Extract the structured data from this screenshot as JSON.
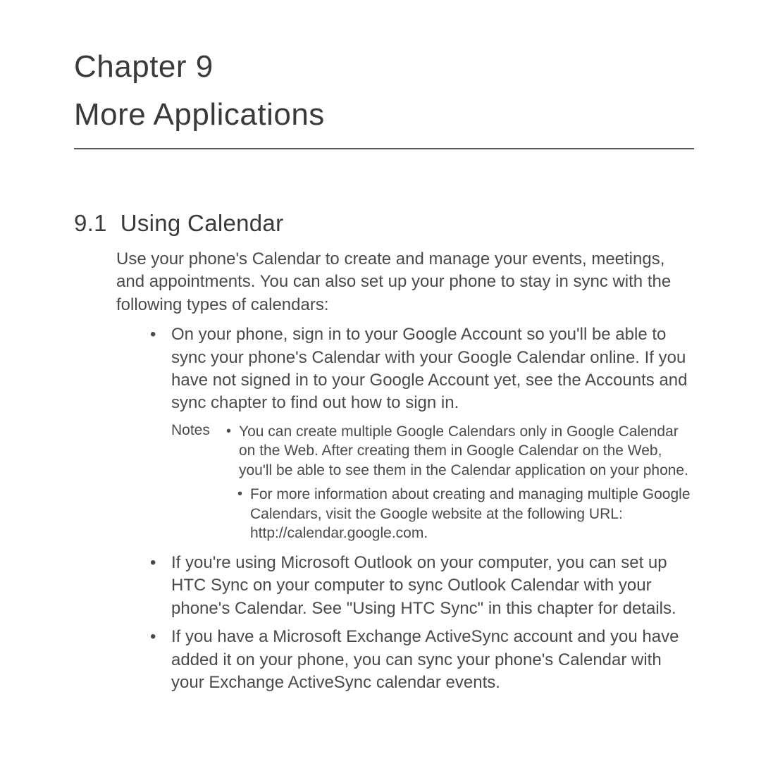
{
  "chapter": {
    "heading": "Chapter 9",
    "title": "More Applications"
  },
  "section": {
    "number": "9.1",
    "title": "Using Calendar",
    "intro": "Use your phone's Calendar to create and manage your events, meetings, and appointments. You can also set up your phone to stay in sync with the following types of calendars:",
    "bullets": [
      "On your phone, sign in to your Google Account so you'll be able to sync your phone's Calendar with your Google Calendar online. If you have not signed in to your Google Account yet, see the Accounts and sync chapter to find out how to sign in.",
      "If you're using Microsoft Outlook on your computer, you can set up HTC Sync on your computer to sync Outlook Calendar with your phone's Calendar. See \"Using HTC Sync\" in this chapter for details.",
      "If you have a Microsoft Exchange ActiveSync account and you have added it on your phone, you can sync your phone's Calendar with your Exchange ActiveSync calendar events."
    ],
    "notes": {
      "label": "Notes",
      "items": [
        "You can create multiple Google Calendars only in Google Calendar on the Web. After creating them in Google Calendar on the Web, you'll be able to see them in the Calendar application on your phone.",
        "For more information about creating and managing multiple Google Calendars, visit the Google website at the following URL: http://calendar.google.com."
      ]
    }
  }
}
